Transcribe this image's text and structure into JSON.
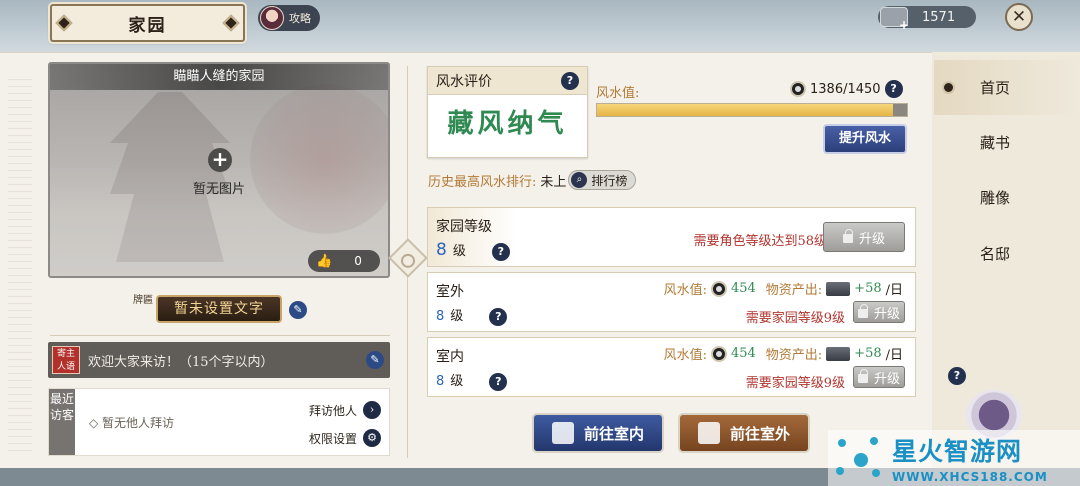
{
  "header": {
    "title": "家园",
    "guide_label": "攻略",
    "currency_amount": "1571",
    "close_glyph": "✕"
  },
  "left": {
    "photo_title": "瞄瞄人缝的家园",
    "add_glyph": "+",
    "no_photo": "暂无图片",
    "likes": "0",
    "plaque_label": "牌匾",
    "plaque_text": "暂未设置文字",
    "seal_text": "寄主人语",
    "welcome_text": "欢迎大家来访！（15个字以内）",
    "visitors_tag": "最近访客",
    "no_visitors": "◇ 暂无他人拜访",
    "visit_others": "拜访他人",
    "permission_settings": "权限设置"
  },
  "fengshui": {
    "card_title": "风水评价",
    "grade": "藏风纳气",
    "value_label": "风水值:",
    "value_text": "1386/1450",
    "value_fraction": 0.956,
    "upgrade_button": "提升风水",
    "rank_label": "历史最高风水排行:",
    "rank_value": "未上",
    "rank_button": "排行榜"
  },
  "rows": {
    "home": {
      "name": "家园等级",
      "level": "8",
      "unit": "级",
      "requirement": "需要角色等级达到58级",
      "button": "升级"
    },
    "outdoor": {
      "name": "室外",
      "level": "8",
      "unit": "级",
      "fs_label": "风水值:",
      "fs_value": "454",
      "output_label": "物资产出:",
      "output_value": "+58",
      "output_unit": "/日",
      "requirement": "需要家园等级9级",
      "button": "升级"
    },
    "indoor": {
      "name": "室内",
      "level": "8",
      "unit": "级",
      "fs_label": "风水值:",
      "fs_value": "454",
      "output_label": "物资产出:",
      "output_value": "+58",
      "output_unit": "/日",
      "requirement": "需要家园等级9级",
      "button": "升级"
    }
  },
  "actions": {
    "go_indoor": "前往室内",
    "go_outdoor": "前往室外"
  },
  "sidebar": {
    "items": [
      {
        "label": "首页"
      },
      {
        "label": "藏书"
      },
      {
        "label": "雕像"
      },
      {
        "label": "名邸"
      }
    ]
  },
  "watermark": {
    "title": "星火智游网",
    "url": "WWW.XHCS188.COM"
  },
  "colors": {
    "accent_blue": "#2c3f7a",
    "accent_brown": "#76441f",
    "warn_red": "#b0352f",
    "good_green": "#2f8a52",
    "gold": "#e5b445"
  }
}
